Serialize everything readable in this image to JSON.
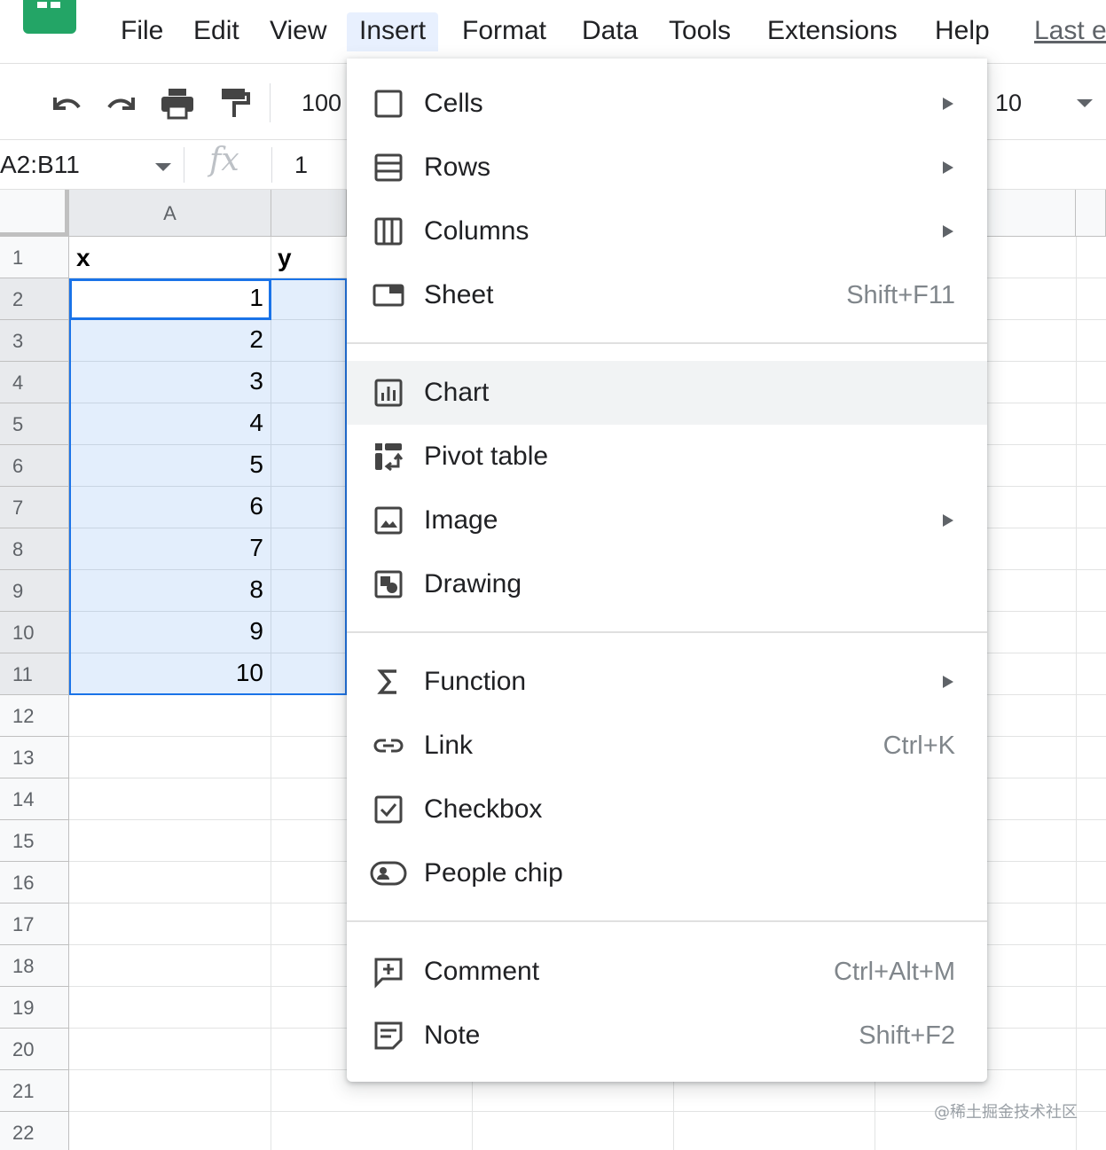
{
  "menubar": {
    "items": [
      "File",
      "Edit",
      "View",
      "Insert",
      "Format",
      "Data",
      "Tools",
      "Extensions",
      "Help"
    ],
    "active": "Insert",
    "last_edit": "Last e"
  },
  "toolbar": {
    "zoom": "100",
    "font_size": "10"
  },
  "formula_bar": {
    "name_box": "A2:B11",
    "fx": "fx",
    "value": "1"
  },
  "grid": {
    "column_headers": [
      "A"
    ],
    "row_numbers": [
      "1",
      "2",
      "3",
      "4",
      "5",
      "6",
      "7",
      "8",
      "9",
      "10",
      "11",
      "12",
      "13",
      "14",
      "15",
      "16",
      "17",
      "18",
      "19",
      "20",
      "21",
      "22"
    ],
    "header_row": [
      "x",
      "y"
    ],
    "column_a_values": [
      "1",
      "2",
      "3",
      "4",
      "5",
      "6",
      "7",
      "8",
      "9",
      "10"
    ],
    "selection": "A2:B11"
  },
  "insert_menu": {
    "groups": [
      [
        {
          "label": "Cells",
          "icon": "cells-icon",
          "submenu": true
        },
        {
          "label": "Rows",
          "icon": "rows-icon",
          "submenu": true
        },
        {
          "label": "Columns",
          "icon": "columns-icon",
          "submenu": true
        },
        {
          "label": "Sheet",
          "icon": "sheet-icon",
          "shortcut": "Shift+F11"
        }
      ],
      [
        {
          "label": "Chart",
          "icon": "chart-icon",
          "hover": true
        },
        {
          "label": "Pivot table",
          "icon": "pivot-table-icon"
        },
        {
          "label": "Image",
          "icon": "image-icon",
          "submenu": true
        },
        {
          "label": "Drawing",
          "icon": "drawing-icon"
        }
      ],
      [
        {
          "label": "Function",
          "icon": "function-sigma-icon",
          "submenu": true
        },
        {
          "label": "Link",
          "icon": "link-icon",
          "shortcut": "Ctrl+K"
        },
        {
          "label": "Checkbox",
          "icon": "checkbox-icon"
        },
        {
          "label": "People chip",
          "icon": "people-chip-icon"
        }
      ],
      [
        {
          "label": "Comment",
          "icon": "comment-icon",
          "shortcut": "Ctrl+Alt+M"
        },
        {
          "label": "Note",
          "icon": "note-icon",
          "shortcut": "Shift+F2"
        }
      ]
    ]
  },
  "watermark": "@稀土掘金技术社区",
  "colors": {
    "accent": "#1a73e8",
    "selection_fill": "#e8f0fe",
    "sheets_green": "#23a566",
    "menu_hover": "#f1f3f4"
  }
}
